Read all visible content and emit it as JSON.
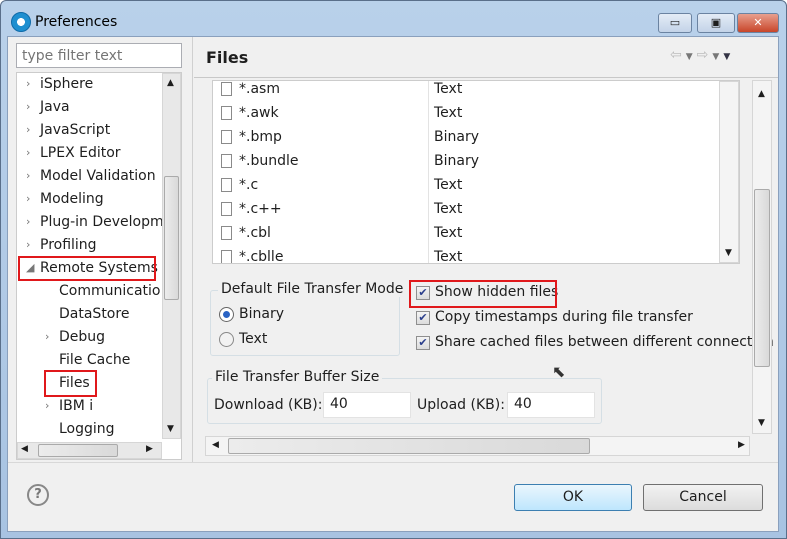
{
  "window": {
    "title": "Preferences",
    "minimize": "▭",
    "maximize": "▣",
    "close": "✕"
  },
  "sidebar": {
    "filter_placeholder": "type filter text",
    "items": [
      {
        "label": "iSphere",
        "expander": "›"
      },
      {
        "label": "Java",
        "expander": "›"
      },
      {
        "label": "JavaScript",
        "expander": "›"
      },
      {
        "label": "LPEX Editor",
        "expander": "›"
      },
      {
        "label": "Model Validation",
        "expander": "›"
      },
      {
        "label": "Modeling",
        "expander": "›"
      },
      {
        "label": "Plug-in Developm",
        "expander": "›"
      },
      {
        "label": "Profiling",
        "expander": "›"
      },
      {
        "label": "Remote Systems",
        "expander": "◢"
      },
      {
        "label": "Communicatio",
        "expander": ""
      },
      {
        "label": "DataStore",
        "expander": ""
      },
      {
        "label": "Debug",
        "expander": "›"
      },
      {
        "label": "File Cache",
        "expander": ""
      },
      {
        "label": "Files",
        "expander": ""
      },
      {
        "label": "IBM i",
        "expander": "›"
      },
      {
        "label": "Logging",
        "expander": ""
      }
    ]
  },
  "page": {
    "title": "Files"
  },
  "file_types": [
    {
      "name": "*.asm",
      "type": "Text"
    },
    {
      "name": "*.awk",
      "type": "Text"
    },
    {
      "name": "*.bmp",
      "type": "Binary"
    },
    {
      "name": "*.bundle",
      "type": "Binary"
    },
    {
      "name": "*.c",
      "type": "Text"
    },
    {
      "name": "*.c++",
      "type": "Text"
    },
    {
      "name": "*.cbl",
      "type": "Text"
    },
    {
      "name": "*.cblle",
      "type": "Text"
    }
  ],
  "transfer_mode": {
    "label": "Default File Transfer Mode",
    "options": [
      {
        "label": "Binary",
        "selected": true
      },
      {
        "label": "Text",
        "selected": false
      }
    ]
  },
  "options": [
    {
      "label": "Show hidden files",
      "checked": true
    },
    {
      "label": "Copy timestamps during file transfer",
      "checked": true
    },
    {
      "label": "Share cached files between different connection",
      "checked": true
    }
  ],
  "buffer": {
    "label": "File Transfer Buffer Size",
    "download_label": "Download (KB):",
    "download_value": "40",
    "upload_label": "Upload (KB):",
    "upload_value": "40"
  },
  "footer": {
    "help": "?",
    "ok": "OK",
    "cancel": "Cancel"
  },
  "highlight_color": "#e0181b"
}
